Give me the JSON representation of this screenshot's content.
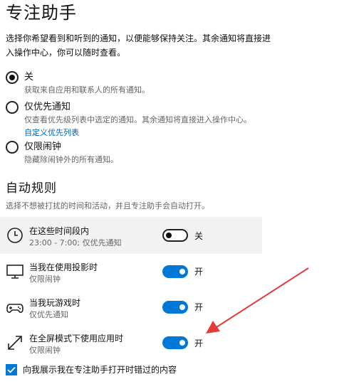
{
  "page": {
    "title": "专注助手",
    "description": "选择你希望看到和听到的通知，以便能够保持关注。其余通知将直接进入操作中心，你可以随时查看。"
  },
  "options": [
    {
      "label": "关",
      "sub": "获取来自应用和联系人的所有通知。",
      "selected": true
    },
    {
      "label": "仅优先通知",
      "sub": "仅查看优先级列表中选定的通知。其余通知将直接进入操作中心。",
      "link": "自定义优先列表",
      "selected": false
    },
    {
      "label": "仅限闹钟",
      "sub": "隐藏除闹钟外的所有通知。",
      "selected": false
    }
  ],
  "auto_rules": {
    "title": "自动规则",
    "description": "选择不想被打扰的时间和活动，并且专注助手会自动打开。",
    "rules": [
      {
        "title": "在这些时间段内",
        "sub": "23:00 - 7:00; 仅优先通知",
        "state": "关",
        "on": false,
        "icon": "clock-icon"
      },
      {
        "title": "当我在使用投影时",
        "sub": "仅限闹钟",
        "state": "开",
        "on": true,
        "icon": "monitor-icon"
      },
      {
        "title": "当我玩游戏时",
        "sub": "仅优先通知",
        "state": "开",
        "on": true,
        "icon": "gamepad-icon"
      },
      {
        "title": "在全屏模式下使用应用时",
        "sub": "仅限闹钟",
        "state": "开",
        "on": true,
        "icon": "fullscreen-icon"
      }
    ]
  },
  "summary_checkbox": {
    "label": "向我展示我在专注助手打开时错过的内容",
    "checked": true
  },
  "colors": {
    "accent": "#0078d7",
    "link": "#0063b1",
    "annotation_arrow": "#e23b3b"
  }
}
